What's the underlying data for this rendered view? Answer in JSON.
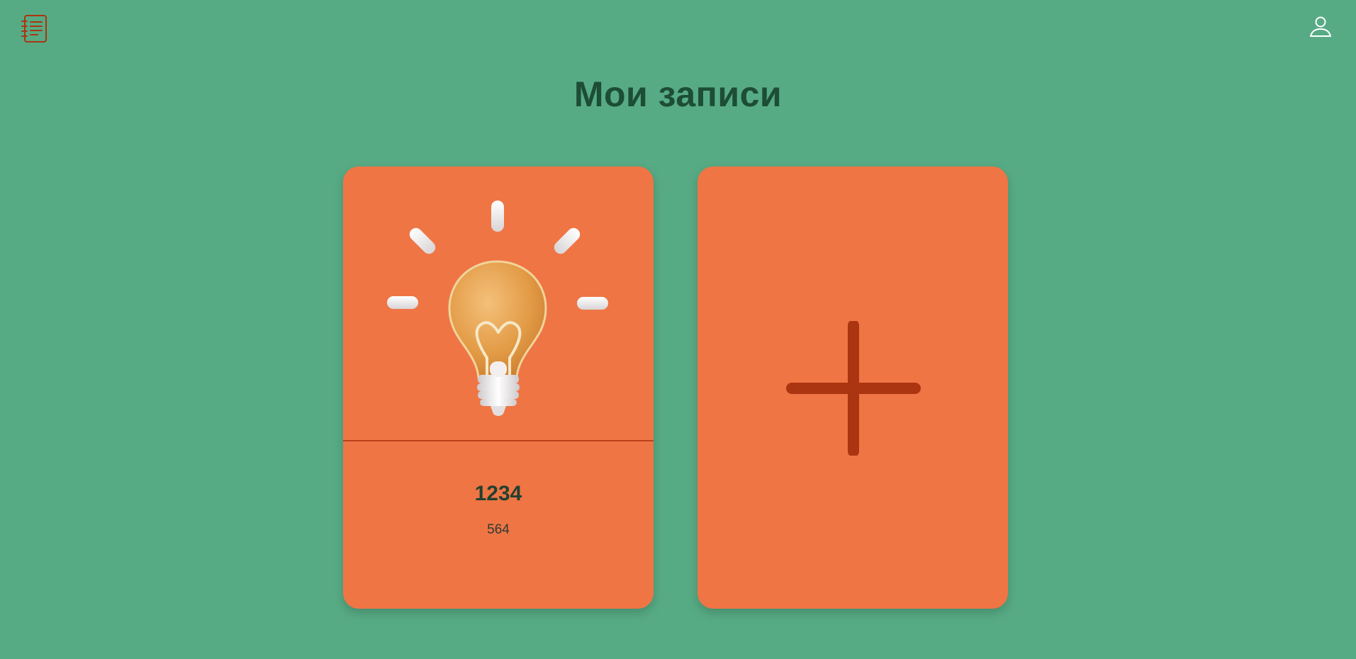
{
  "header": {
    "logo_icon": "notebook-icon",
    "profile_icon": "user-icon",
    "title": "Мои записи"
  },
  "colors": {
    "background": "#57ab84",
    "card": "#ef7545",
    "accent_dark": "#aa3510",
    "title": "#1d4d35"
  },
  "notes": [
    {
      "title": "1234",
      "text": "564",
      "image_icon": "lightbulb-icon"
    }
  ],
  "add_card": {
    "icon": "plus-icon"
  }
}
